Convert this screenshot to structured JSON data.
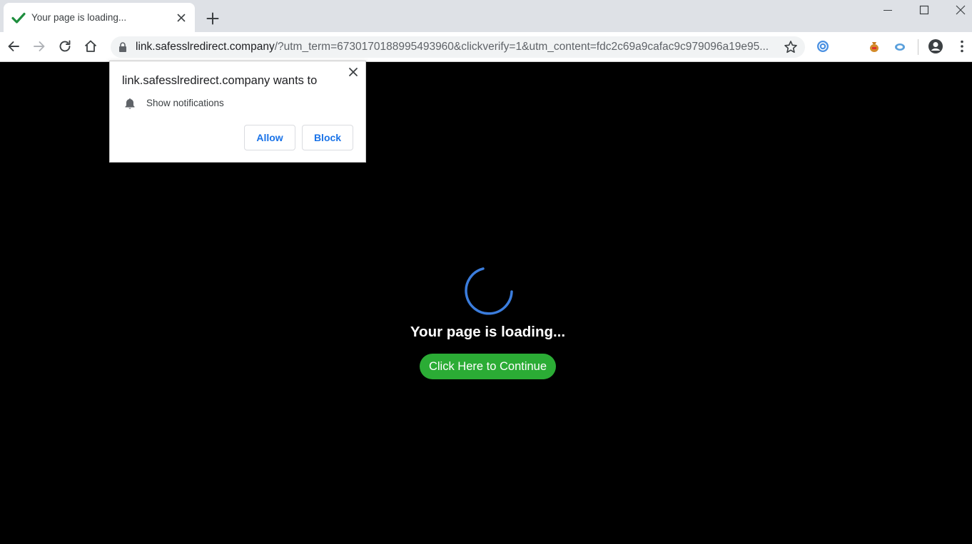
{
  "browser": {
    "tab": {
      "title": "Your page is loading...",
      "favicon": "checkmark-icon"
    },
    "address_bar": {
      "host": "link.safesslredirect.company",
      "path": "/?utm_term=6730170188995493960&clickverify=1&utm_content=fdc2c69a9cafac9c979096a19e95..."
    }
  },
  "permission_prompt": {
    "title": "link.safesslredirect.company wants to",
    "permission": "Show notifications",
    "allow_label": "Allow",
    "block_label": "Block"
  },
  "page": {
    "loading_text": "Your page is loading...",
    "continue_label": "Click Here to Continue"
  },
  "colors": {
    "page_background": "#000000",
    "continue_button": "#2bac35",
    "spinner": "#3b7ddd",
    "prompt_button_text": "#1a73e8",
    "tab_strip": "#dee1e6"
  }
}
